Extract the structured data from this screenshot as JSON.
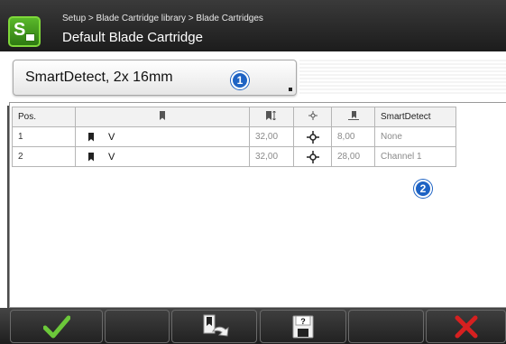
{
  "header": {
    "breadcrumb": "Setup > Blade Cartridge library > Blade Cartridges",
    "title": "Default Blade Cartridge",
    "app_icon": "s-app-icon"
  },
  "cartridge_select": {
    "value": "SmartDetect, 2x 16mm"
  },
  "badges": [
    "1",
    "2"
  ],
  "table": {
    "headers": {
      "pos": "Pos.",
      "name_icon": "blade-icon",
      "height_icon": "blade-height-icon",
      "center_icon": "crosshair-icon",
      "offset_icon": "offset-icon",
      "smartdetect": "SmartDetect"
    },
    "rows": [
      {
        "pos": "1",
        "name": "V",
        "height": "32,00",
        "offset": "8,00",
        "smartdetect": "None"
      },
      {
        "pos": "2",
        "name": "V",
        "height": "32,00",
        "offset": "28,00",
        "smartdetect": "Channel 1"
      }
    ]
  },
  "toolbar": {
    "buttons": [
      "checkmark-icon",
      "blade-library-icon",
      "save-as-icon",
      "close-icon"
    ]
  },
  "colors": {
    "accent_green": "#5ab82a",
    "badge_blue": "#1e63c4",
    "cancel_red": "#d62020"
  }
}
